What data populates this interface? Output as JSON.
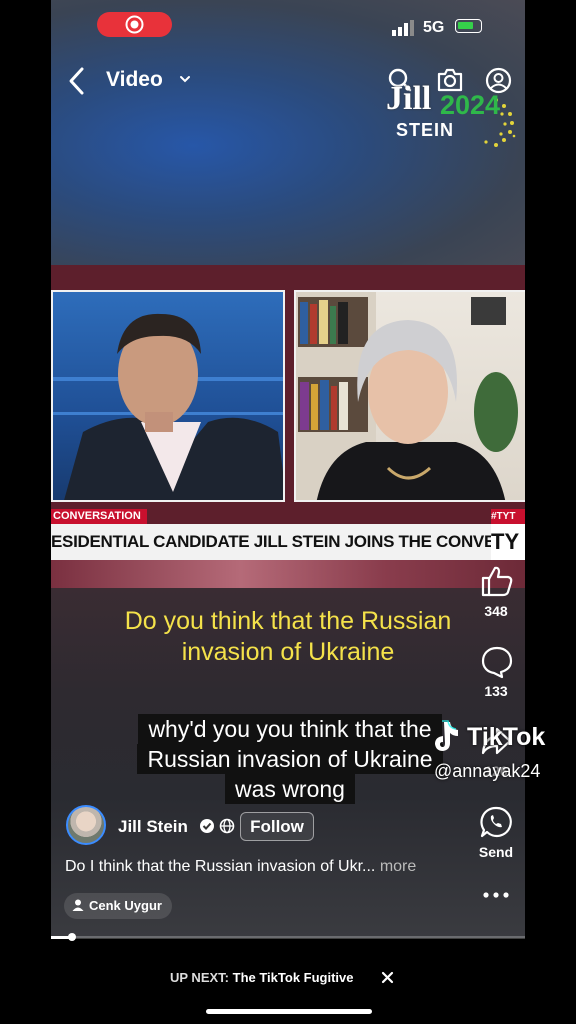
{
  "status_bar": {
    "network": "5G"
  },
  "header": {
    "title": "Video"
  },
  "logo_overlay": {
    "line1": "Jill",
    "year": "2024",
    "line2": "STEIN"
  },
  "video": {
    "conversation_tag": "CONVERSATION",
    "headline": "ESIDENTIAL CANDIDATE JILL STEIN JOINS THE CONVERSATION",
    "channel_tag": "#TYT",
    "channel_logo": "TY"
  },
  "captions": {
    "yellow": [
      "Do you think that the Russian",
      "invasion of Ukraine"
    ],
    "white": [
      "why'd you you think that the",
      "Russian invasion of Ukraine",
      "was wrong"
    ]
  },
  "actions": {
    "likes": "348",
    "comments": "133",
    "share_count": "126",
    "send_label": "Send"
  },
  "watermark": {
    "brand": "TikTok",
    "handle": "@annayak24"
  },
  "author": {
    "name": "Jill Stein",
    "follow_label": "Follow"
  },
  "description": {
    "text": "Do I think that the Russian invasion of Ukr...",
    "more": "more"
  },
  "mention_chip": {
    "label": "Cenk Uygur"
  },
  "up_next": {
    "prefix": "UP NEXT:",
    "title": "The TikTok Fugitive"
  }
}
